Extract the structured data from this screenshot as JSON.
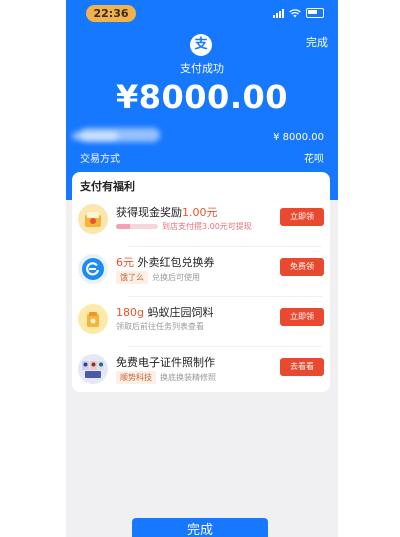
{
  "status_bar": {
    "time": "22:36"
  },
  "header": {
    "done_label": "完成",
    "logo_glyph": "支",
    "status_text": "支付成功",
    "amount": "¥8000.00",
    "amount_small": "¥ 8000.00",
    "method_label": "交易方式",
    "method_value": "花呗"
  },
  "benefits": {
    "title": "支付有福利",
    "items": [
      {
        "icon": "cash-reward-icon",
        "title": "获得现金奖励",
        "title_highlight": "1.00元",
        "subtitle": "到店支付攒3.00元可提现",
        "progress": 0.33,
        "button": "立即领"
      },
      {
        "icon": "eleme-icon",
        "title_highlight": "6元",
        "title": "外卖红包兑换券",
        "tag": "饿了么",
        "subtitle": "兑换后可使用",
        "button": "免费领"
      },
      {
        "icon": "ant-farm-icon",
        "title_highlight": "180g",
        "title": "蚂蚁庄园饲料",
        "subtitle": "领取后前往任务列表查看",
        "button": "立即领"
      },
      {
        "icon": "id-photo-icon",
        "title": "免费电子证件照制作",
        "tag": "顺势科技",
        "subtitle": "换底换装精修照",
        "button": "去看看"
      }
    ]
  },
  "footer": {
    "done_label": "完成"
  },
  "colors": {
    "brand_blue": "#1677ff",
    "action_red": "#e94a2f",
    "highlight": "#e8542e"
  }
}
